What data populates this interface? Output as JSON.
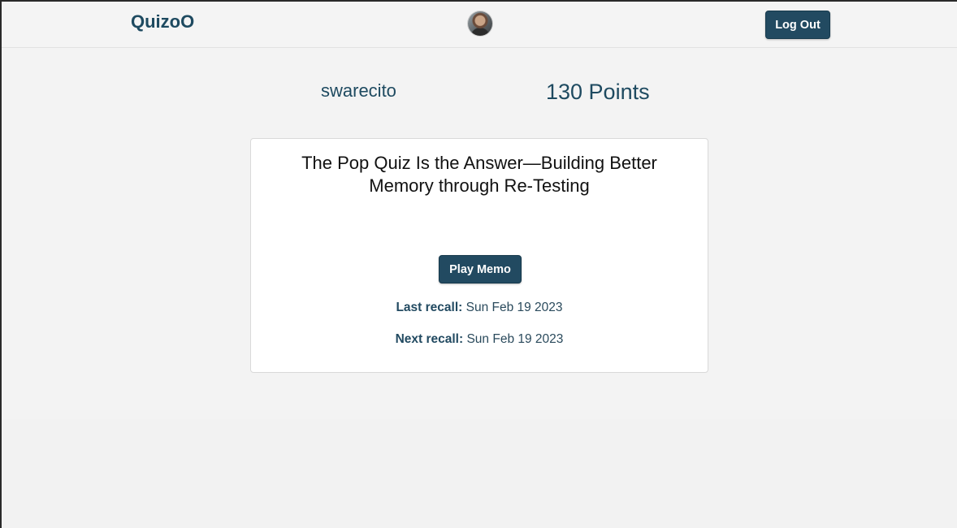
{
  "header": {
    "brand": "QuizoO",
    "logout_label": "Log Out"
  },
  "profile": {
    "username": "swarecito",
    "points": "130 Points"
  },
  "memo": {
    "title": "The Pop Quiz Is the Answer—Building Better Memory through Re-Testing",
    "play_label": "Play Memo",
    "last_recall_label": "Last recall:",
    "last_recall_value": "Sun Feb 19 2023",
    "next_recall_label": "Next recall:",
    "next_recall_value": "Sun Feb 19 2023"
  },
  "colors": {
    "primary": "#224a61",
    "background": "#f3f3f3",
    "card": "#ffffff"
  },
  "icons": {
    "avatar": "user-avatar"
  }
}
